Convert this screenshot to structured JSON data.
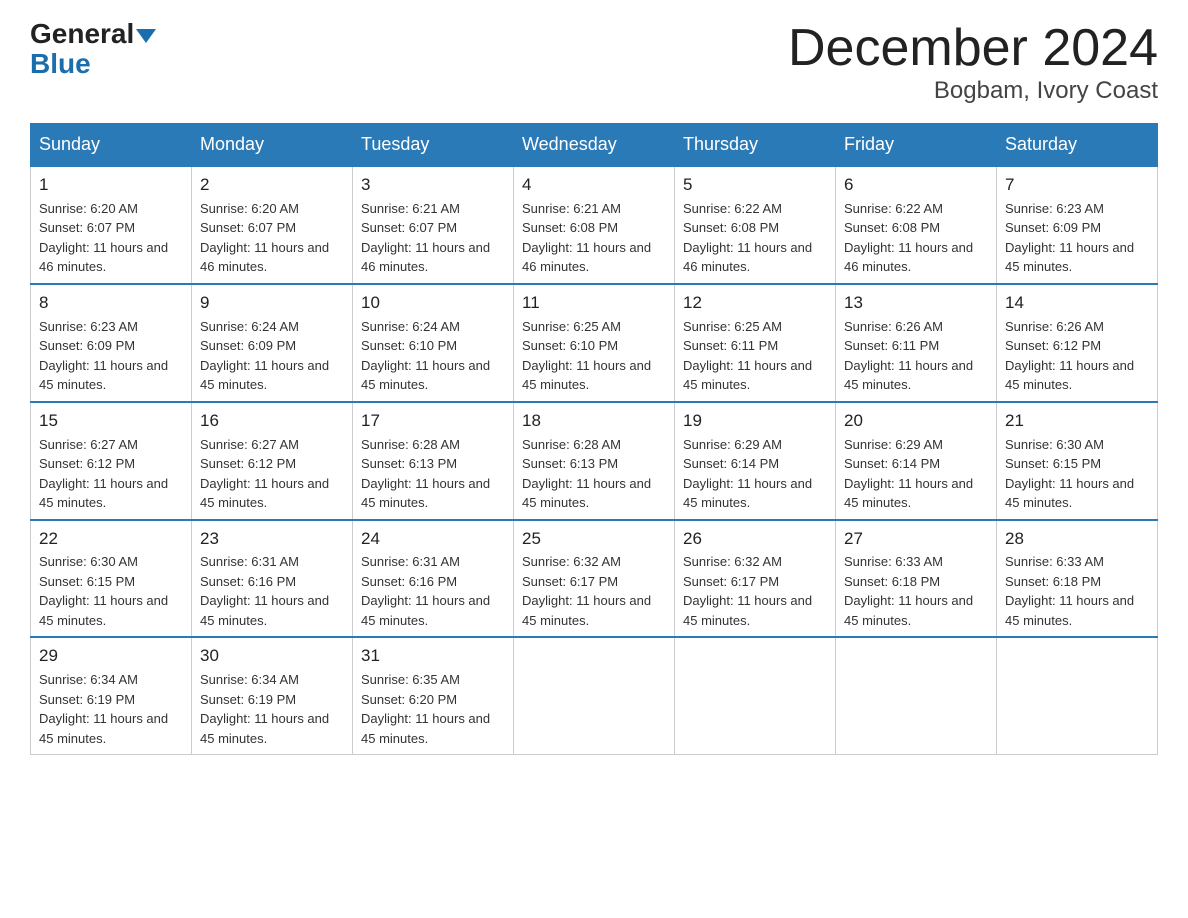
{
  "logo": {
    "general": "General",
    "blue": "Blue"
  },
  "title": "December 2024",
  "location": "Bogbam, Ivory Coast",
  "weekdays": [
    "Sunday",
    "Monday",
    "Tuesday",
    "Wednesday",
    "Thursday",
    "Friday",
    "Saturday"
  ],
  "weeks": [
    [
      {
        "day": "1",
        "sunrise": "6:20 AM",
        "sunset": "6:07 PM",
        "daylight": "11 hours and 46 minutes."
      },
      {
        "day": "2",
        "sunrise": "6:20 AM",
        "sunset": "6:07 PM",
        "daylight": "11 hours and 46 minutes."
      },
      {
        "day": "3",
        "sunrise": "6:21 AM",
        "sunset": "6:07 PM",
        "daylight": "11 hours and 46 minutes."
      },
      {
        "day": "4",
        "sunrise": "6:21 AM",
        "sunset": "6:08 PM",
        "daylight": "11 hours and 46 minutes."
      },
      {
        "day": "5",
        "sunrise": "6:22 AM",
        "sunset": "6:08 PM",
        "daylight": "11 hours and 46 minutes."
      },
      {
        "day": "6",
        "sunrise": "6:22 AM",
        "sunset": "6:08 PM",
        "daylight": "11 hours and 46 minutes."
      },
      {
        "day": "7",
        "sunrise": "6:23 AM",
        "sunset": "6:09 PM",
        "daylight": "11 hours and 45 minutes."
      }
    ],
    [
      {
        "day": "8",
        "sunrise": "6:23 AM",
        "sunset": "6:09 PM",
        "daylight": "11 hours and 45 minutes."
      },
      {
        "day": "9",
        "sunrise": "6:24 AM",
        "sunset": "6:09 PM",
        "daylight": "11 hours and 45 minutes."
      },
      {
        "day": "10",
        "sunrise": "6:24 AM",
        "sunset": "6:10 PM",
        "daylight": "11 hours and 45 minutes."
      },
      {
        "day": "11",
        "sunrise": "6:25 AM",
        "sunset": "6:10 PM",
        "daylight": "11 hours and 45 minutes."
      },
      {
        "day": "12",
        "sunrise": "6:25 AM",
        "sunset": "6:11 PM",
        "daylight": "11 hours and 45 minutes."
      },
      {
        "day": "13",
        "sunrise": "6:26 AM",
        "sunset": "6:11 PM",
        "daylight": "11 hours and 45 minutes."
      },
      {
        "day": "14",
        "sunrise": "6:26 AM",
        "sunset": "6:12 PM",
        "daylight": "11 hours and 45 minutes."
      }
    ],
    [
      {
        "day": "15",
        "sunrise": "6:27 AM",
        "sunset": "6:12 PM",
        "daylight": "11 hours and 45 minutes."
      },
      {
        "day": "16",
        "sunrise": "6:27 AM",
        "sunset": "6:12 PM",
        "daylight": "11 hours and 45 minutes."
      },
      {
        "day": "17",
        "sunrise": "6:28 AM",
        "sunset": "6:13 PM",
        "daylight": "11 hours and 45 minutes."
      },
      {
        "day": "18",
        "sunrise": "6:28 AM",
        "sunset": "6:13 PM",
        "daylight": "11 hours and 45 minutes."
      },
      {
        "day": "19",
        "sunrise": "6:29 AM",
        "sunset": "6:14 PM",
        "daylight": "11 hours and 45 minutes."
      },
      {
        "day": "20",
        "sunrise": "6:29 AM",
        "sunset": "6:14 PM",
        "daylight": "11 hours and 45 minutes."
      },
      {
        "day": "21",
        "sunrise": "6:30 AM",
        "sunset": "6:15 PM",
        "daylight": "11 hours and 45 minutes."
      }
    ],
    [
      {
        "day": "22",
        "sunrise": "6:30 AM",
        "sunset": "6:15 PM",
        "daylight": "11 hours and 45 minutes."
      },
      {
        "day": "23",
        "sunrise": "6:31 AM",
        "sunset": "6:16 PM",
        "daylight": "11 hours and 45 minutes."
      },
      {
        "day": "24",
        "sunrise": "6:31 AM",
        "sunset": "6:16 PM",
        "daylight": "11 hours and 45 minutes."
      },
      {
        "day": "25",
        "sunrise": "6:32 AM",
        "sunset": "6:17 PM",
        "daylight": "11 hours and 45 minutes."
      },
      {
        "day": "26",
        "sunrise": "6:32 AM",
        "sunset": "6:17 PM",
        "daylight": "11 hours and 45 minutes."
      },
      {
        "day": "27",
        "sunrise": "6:33 AM",
        "sunset": "6:18 PM",
        "daylight": "11 hours and 45 minutes."
      },
      {
        "day": "28",
        "sunrise": "6:33 AM",
        "sunset": "6:18 PM",
        "daylight": "11 hours and 45 minutes."
      }
    ],
    [
      {
        "day": "29",
        "sunrise": "6:34 AM",
        "sunset": "6:19 PM",
        "daylight": "11 hours and 45 minutes."
      },
      {
        "day": "30",
        "sunrise": "6:34 AM",
        "sunset": "6:19 PM",
        "daylight": "11 hours and 45 minutes."
      },
      {
        "day": "31",
        "sunrise": "6:35 AM",
        "sunset": "6:20 PM",
        "daylight": "11 hours and 45 minutes."
      },
      null,
      null,
      null,
      null
    ]
  ],
  "labels": {
    "sunrise": "Sunrise:",
    "sunset": "Sunset:",
    "daylight": "Daylight:"
  }
}
